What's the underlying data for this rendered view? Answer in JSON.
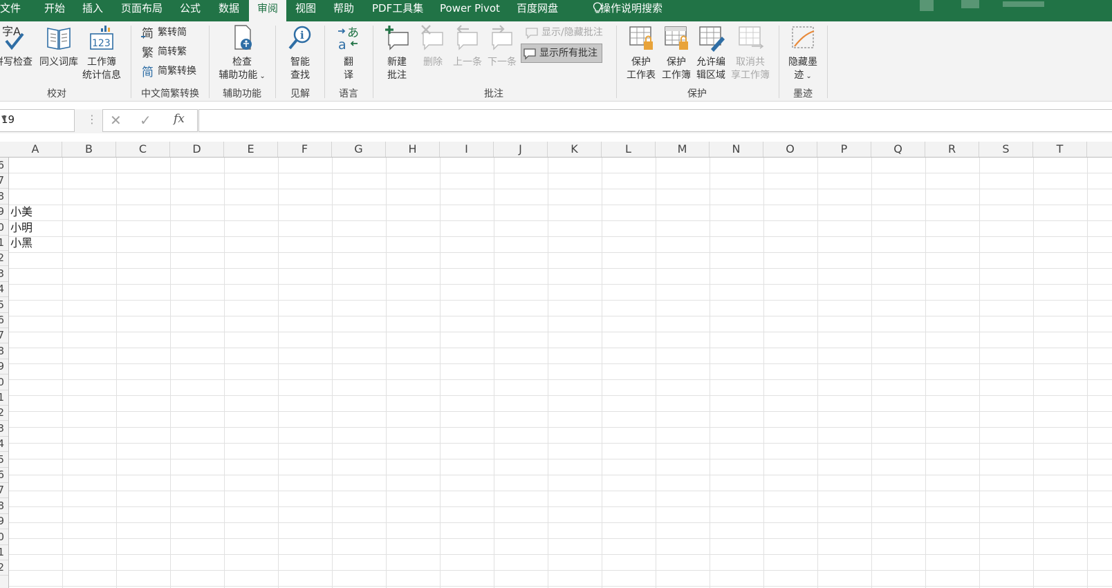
{
  "tabs": [
    "文件",
    "开始",
    "插入",
    "页面布局",
    "公式",
    "数据",
    "审阅",
    "视图",
    "帮助",
    "PDF工具集",
    "Power Pivot",
    "百度网盘"
  ],
  "active_tab": "审阅",
  "tell_me": "操作说明搜索",
  "ribbon": {
    "proofing": {
      "spelling_line1": "拼写检查",
      "thesaurus": "同义词库",
      "stats_line1": "工作簿",
      "stats_line2": "统计信息",
      "group": "校对"
    },
    "chinese": {
      "to_simplified": "繁转简",
      "to_traditional": "简转繁",
      "convert": "简繁转换",
      "group": "中文简繁转换"
    },
    "accessibility": {
      "line1": "检查",
      "line2": "辅助功能",
      "group": "辅助功能"
    },
    "insights": {
      "line1": "智能",
      "line2": "查找",
      "group": "见解"
    },
    "language": {
      "line1": "翻",
      "line2": "译",
      "group": "语言"
    },
    "comments": {
      "new_line1": "新建",
      "new_line2": "批注",
      "delete": "删除",
      "previous": "上一条",
      "next": "下一条",
      "show_hide": "显示/隐藏批注",
      "show_all": "显示所有批注",
      "group": "批注"
    },
    "protect": {
      "sheet_line1": "保护",
      "sheet_line2": "工作表",
      "wb_line1": "保护",
      "wb_line2": "工作簿",
      "allow_line1": "允许编",
      "allow_line2": "辑区域",
      "unshare_line1": "取消共",
      "unshare_line2": "享工作簿",
      "group": "保护"
    },
    "ink": {
      "line1": "隐藏墨",
      "line2": "迹",
      "group": "墨迹"
    }
  },
  "formula_bar": {
    "name_box": "19",
    "formula": ""
  },
  "columns": [
    "A",
    "B",
    "C",
    "D",
    "E",
    "F",
    "G",
    "H",
    "I",
    "J",
    "K",
    "L",
    "M",
    "N",
    "O",
    "P",
    "Q",
    "R",
    "S",
    "T"
  ],
  "row_numbers": [
    "6",
    "7",
    "8",
    "9",
    "0",
    "1",
    "2",
    "3",
    "4",
    "5",
    "6",
    "7",
    "8",
    "9",
    "0",
    "1",
    "2",
    "3",
    "4",
    "5",
    "6",
    "7",
    "8",
    "9",
    "0",
    "1",
    "2"
  ],
  "cells_col_a": [
    "",
    "",
    "",
    "小美",
    "小明",
    "小黑"
  ],
  "colors": {
    "accent": "#217346",
    "ribbon_bg": "#f3f3f3",
    "icon_blue": "#2f6ea5"
  }
}
